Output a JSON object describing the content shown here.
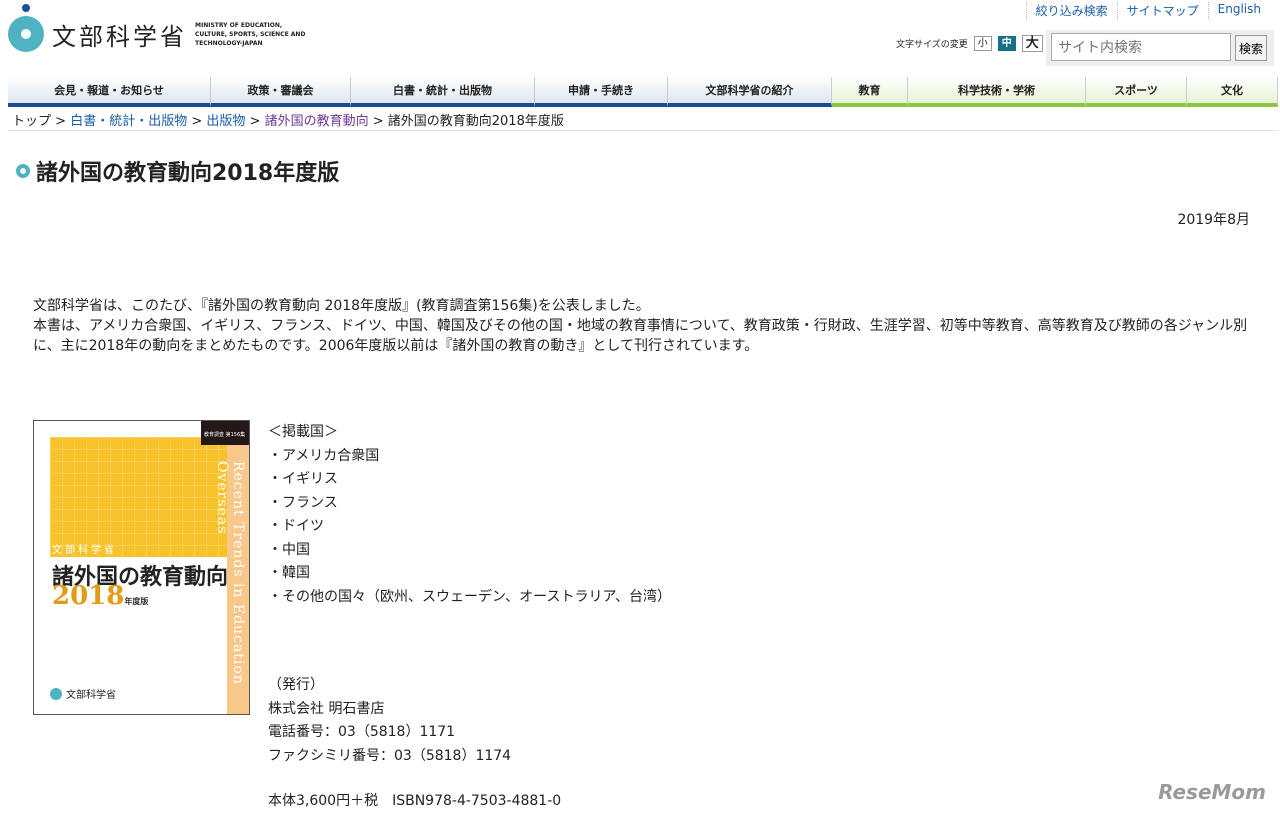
{
  "header": {
    "logo_jp": "文部科学省",
    "logo_en": "MINISTRY OF EDUCATION, CULTURE, SPORTS, SCIENCE AND TECHNOLOGY-JAPAN",
    "top_links": [
      "絞り込み検索",
      "サイトマップ",
      "English"
    ],
    "font_size_label": "文字サイズの変更",
    "font_sizes": [
      "小",
      "中",
      "大"
    ],
    "search_placeholder": "サイト内検索",
    "search_button": "検索"
  },
  "nav": [
    "会見・報道・お知らせ",
    "政策・審議会",
    "白書・統計・出版物",
    "申請・手続き",
    "文部科学省の紹介",
    "教育",
    "科学技術・学術",
    "スポーツ",
    "文化"
  ],
  "breadcrumb": [
    "トップ",
    "白書・統計・出版物",
    "出版物",
    "諸外国の教育動向",
    "諸外国の教育動向2018年度版"
  ],
  "title": "諸外国の教育動向2018年度版",
  "date": "2019年8月",
  "intro": [
    "文部科学省は、このたび、『諸外国の教育動向 2018年度版』(教育調査第156集)を公表しました。",
    "本書は、アメリカ合衆国、イギリス、フランス、ドイツ、中国、韓国及びその他の国・地域の教育事情について、教育政策・行財政、生涯学習、初等中等教育、高等教育及び教師の各ジャンル別に、主に2018年の動向をまとめたものです。2006年度版以前は『諸外国の教育の動き』として刊行されています。"
  ],
  "cover": {
    "tag": "教育調査 第156集",
    "subtitle": "文部科学省",
    "title": "諸外国の教育動向",
    "year": "2018",
    "year_suffix": "年度版",
    "vertical": "Recent Trends in Education Overseas",
    "publisher_logo": "文部科学省"
  },
  "countries": {
    "heading": "＜掲載国＞",
    "items": [
      "・アメリカ合衆国",
      "・イギリス",
      "・フランス",
      "・ドイツ",
      "・中国",
      "・韓国",
      "・その他の国々（欧州、スウェーデン、オーストラリア、台湾）"
    ]
  },
  "publisher": [
    "（発行）",
    "株式会社 明石書店",
    "電話番号：03（5818）1171",
    "ファクシミリ番号：03（5818）1174"
  ],
  "price": "本体3,600円＋税　ISBN978-4-7503-4881-0",
  "watermark": "ReseMom"
}
